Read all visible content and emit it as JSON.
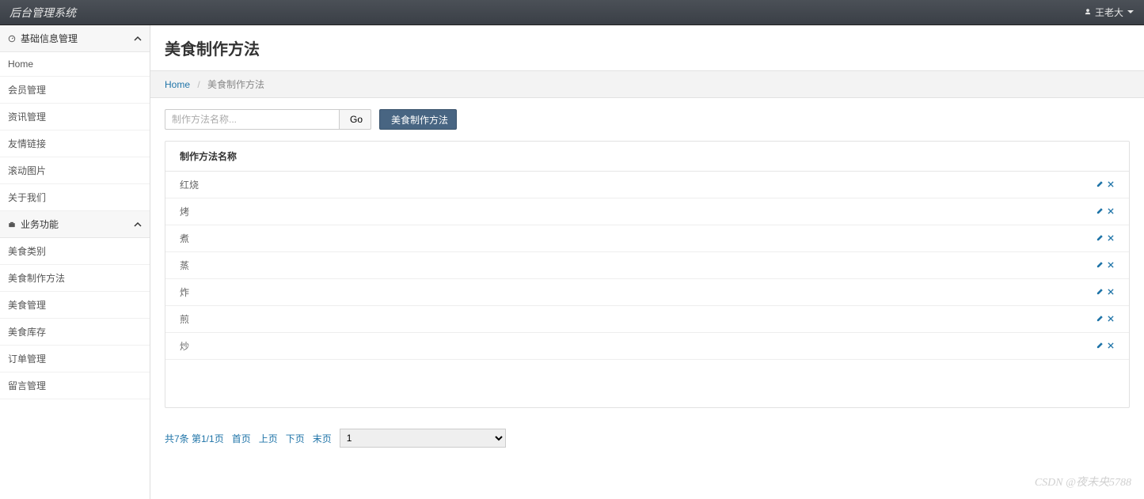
{
  "header": {
    "brand": "后台管理系统",
    "user": "王老大"
  },
  "sidebar": {
    "groups": [
      {
        "title": "基础信息管理",
        "items": [
          "Home",
          "会员管理",
          "资讯管理",
          "友情链接",
          "滚动图片",
          "关于我们"
        ]
      },
      {
        "title": "业务功能",
        "items": [
          "美食类别",
          "美食制作方法",
          "美食管理",
          "美食库存",
          "订单管理",
          "留言管理"
        ]
      }
    ]
  },
  "page": {
    "title": "美食制作方法",
    "breadcrumb": {
      "home_label": "Home",
      "current": "美食制作方法"
    }
  },
  "controls": {
    "search_placeholder": "制作方法名称...",
    "go_label": "Go",
    "add_label": "美食制作方法"
  },
  "table": {
    "header": "制作方法名称",
    "rows": [
      "红烧",
      "烤",
      "煮",
      "蒸",
      "炸",
      "煎",
      "炒"
    ]
  },
  "pager": {
    "summary": "共7条 第1/1页",
    "first": "首页",
    "prev": "上页",
    "next": "下页",
    "last": "末页",
    "selected": "1"
  },
  "watermark": "CSDN @夜未央5788"
}
